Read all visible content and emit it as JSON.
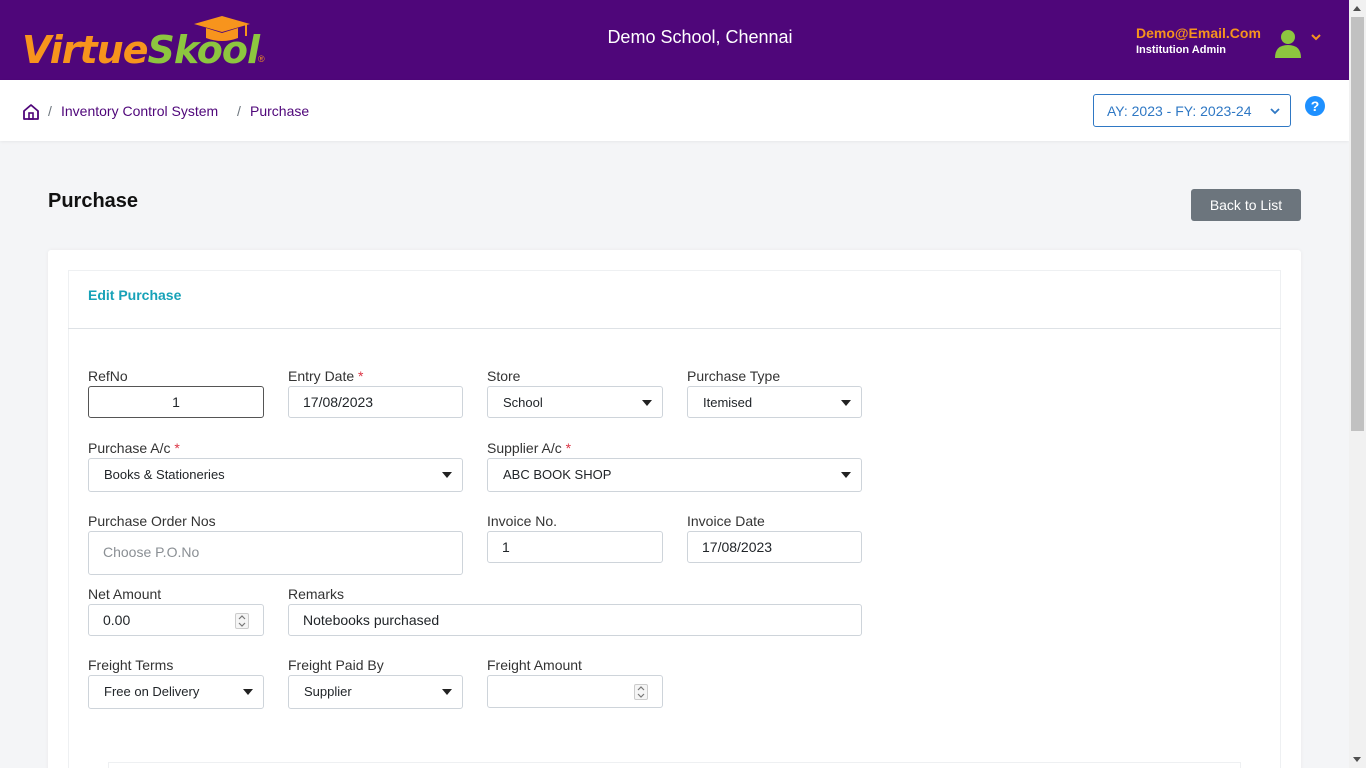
{
  "header": {
    "logo_part1": "Virtue",
    "logo_part2": "Skool",
    "logo_reg": "®",
    "school_name": "Demo School, Chennai",
    "user_email": "Demo@Email.Com",
    "user_role": "Institution Admin"
  },
  "breadcrumb": {
    "sep": "/",
    "items": [
      "Inventory Control System",
      "Purchase"
    ]
  },
  "academic_year": {
    "label": "AY: 2023 - FY: 2023-24"
  },
  "help": {
    "label": "?"
  },
  "page": {
    "title": "Purchase",
    "back_label": "Back to List"
  },
  "card": {
    "title": "Edit Purchase"
  },
  "form": {
    "refno": {
      "label": "RefNo",
      "value": "1"
    },
    "entry_date": {
      "label": "Entry Date",
      "required": "*",
      "value": "17/08/2023"
    },
    "store": {
      "label": "Store",
      "value": "School"
    },
    "purchase_type": {
      "label": "Purchase Type",
      "value": "Itemised"
    },
    "purchase_ac": {
      "label": "Purchase A/c",
      "required": "*",
      "value": "Books & Stationeries"
    },
    "supplier_ac": {
      "label": "Supplier A/c",
      "required": "*",
      "value": "ABC BOOK SHOP"
    },
    "po_nos": {
      "label": "Purchase Order Nos",
      "placeholder": "Choose P.O.No"
    },
    "invoice_no": {
      "label": "Invoice No.",
      "value": "1"
    },
    "invoice_date": {
      "label": "Invoice Date",
      "value": "17/08/2023"
    },
    "net_amount": {
      "label": "Net Amount",
      "value": "0.00"
    },
    "remarks": {
      "label": "Remarks",
      "value": "Notebooks purchased"
    },
    "freight_terms": {
      "label": "Freight Terms",
      "value": "Free on Delivery"
    },
    "freight_paid_by": {
      "label": "Freight Paid By",
      "value": "Supplier"
    },
    "freight_amount": {
      "label": "Freight Amount",
      "value": ""
    }
  },
  "colors": {
    "brand_purple": "#4f067a",
    "logo_orange": "#f7941d",
    "logo_green": "#8dc63f",
    "card_title": "#17a2b8",
    "required": "#dc3545"
  }
}
